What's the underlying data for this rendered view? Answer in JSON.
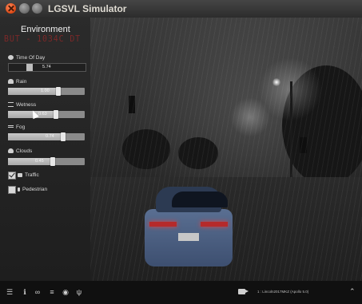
{
  "window": {
    "title": "LGSVL Simulator"
  },
  "panel": {
    "title": "Environment",
    "overlay_text": "BUT - 1034C DT",
    "time_of_day": {
      "label": "Time Of Day",
      "value": "5.74"
    },
    "sliders": [
      {
        "key": "rain",
        "label": "Rain",
        "value": "1.00",
        "fill": 0.66
      },
      {
        "key": "wetness",
        "label": "Wetness",
        "value": "0.63",
        "fill": 0.62
      },
      {
        "key": "fog",
        "label": "Fog",
        "value": "0.74",
        "fill": 0.72
      },
      {
        "key": "clouds",
        "label": "Clouds",
        "value": "0.45",
        "fill": 0.58
      }
    ],
    "checkboxes": [
      {
        "key": "traffic",
        "label": "Traffic",
        "checked": true
      },
      {
        "key": "pedestrian",
        "label": "Pedestrian",
        "checked": false
      }
    ]
  },
  "bottombar": {
    "icons": [
      "menu-icon",
      "info-icon",
      "link-icon",
      "settings-icon",
      "eye-icon",
      "plug-icon",
      "camera-icon",
      "chevron-up-icon"
    ],
    "status_text": "1 : Lincoln2017MKZ (Apollo 5.0)"
  }
}
